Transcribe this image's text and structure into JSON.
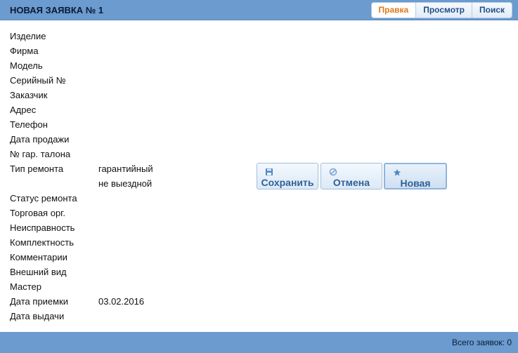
{
  "header": {
    "title": "НОВАЯ ЗАЯВКА № 1",
    "tabs": [
      {
        "label": "Правка",
        "active": true
      },
      {
        "label": "Просмотр",
        "active": false
      },
      {
        "label": "Поиск",
        "active": false
      }
    ]
  },
  "form": {
    "fields": [
      {
        "label": "Изделие",
        "value": ""
      },
      {
        "label": "Фирма",
        "value": ""
      },
      {
        "label": "Модель",
        "value": ""
      },
      {
        "label": "Серийный №",
        "value": ""
      },
      {
        "label": "Заказчик",
        "value": ""
      },
      {
        "label": "Адрес",
        "value": ""
      },
      {
        "label": "Телефон",
        "value": ""
      },
      {
        "label": "Дата продажи",
        "value": ""
      },
      {
        "label": "№ гар. талона",
        "value": ""
      },
      {
        "label": "Тип ремонта",
        "value": "гарантийный"
      },
      {
        "label": "",
        "value": "не выездной"
      },
      {
        "label": "Статус ремонта",
        "value": ""
      },
      {
        "label": "Торговая орг.",
        "value": ""
      },
      {
        "label": "Неисправность",
        "value": ""
      },
      {
        "label": "Комплектность",
        "value": ""
      },
      {
        "label": "Комментарии",
        "value": ""
      },
      {
        "label": "Внешний вид",
        "value": ""
      },
      {
        "label": "Мастер",
        "value": ""
      },
      {
        "label": "Дата приемки",
        "value": "03.02.2016"
      },
      {
        "label": "Дата выдачи",
        "value": ""
      }
    ]
  },
  "actions": {
    "save_label": "Сохранить",
    "cancel_label": "Отмена",
    "new_label": "Новая",
    "save_icon": "floppy-icon",
    "cancel_icon": "cancel-icon",
    "new_icon": "star-icon"
  },
  "footer": {
    "count_text": "Всего заявок: 0"
  },
  "colors": {
    "bar": "#6b9bcf",
    "active_tab": "#e07a16",
    "button_text": "#2d6199"
  }
}
